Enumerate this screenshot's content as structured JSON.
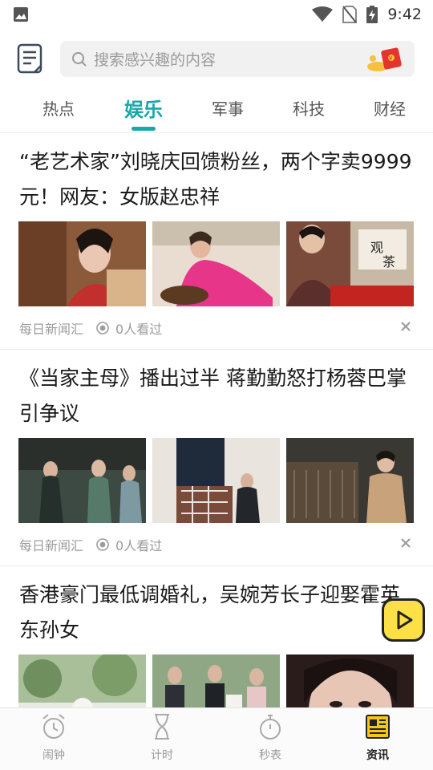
{
  "status_bar": {
    "time": "9:42"
  },
  "search": {
    "placeholder": "搜索感兴趣的内容"
  },
  "tabs": [
    {
      "label": "热点"
    },
    {
      "label": "娱乐"
    },
    {
      "label": "军事"
    },
    {
      "label": "科技"
    },
    {
      "label": "财经"
    }
  ],
  "active_tab": "娱乐",
  "articles": [
    {
      "title": "“老艺术家”刘晓庆回馈粉丝，两个字卖9999元！网友：女版赵忠祥",
      "source": "每日新闻汇",
      "views": "0人看过"
    },
    {
      "title": "《当家主母》播出过半 蒋勤勤怒打杨蓉巴掌引争议",
      "source": "每日新闻汇",
      "views": "0人看过"
    },
    {
      "title": "香港豪门最低调婚礼，吴婉芳长子迎娶霍英东孙女",
      "source": "",
      "views": ""
    }
  ],
  "bottom_nav": [
    {
      "label": "闹钟",
      "icon": "alarm-clock-icon"
    },
    {
      "label": "计时",
      "icon": "hourglass-icon"
    },
    {
      "label": "秒表",
      "icon": "stopwatch-icon"
    },
    {
      "label": "资讯",
      "icon": "newspaper-icon"
    }
  ],
  "colors": {
    "accent": "#19a8a8",
    "float_button": "#fde047"
  }
}
